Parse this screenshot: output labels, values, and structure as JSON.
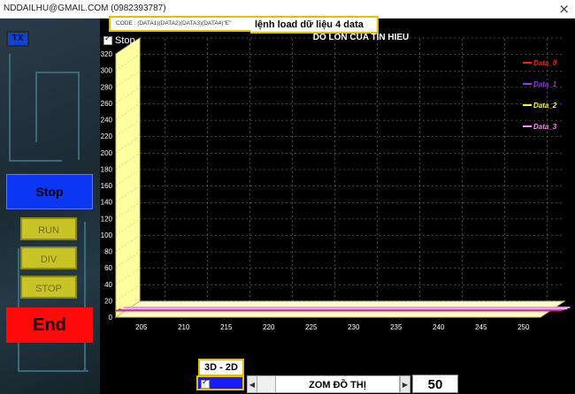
{
  "window": {
    "title": "NDDAILHU@GMAIL.COM (0982393787)",
    "close_glyph": "×"
  },
  "left_panel": {
    "tx_label": "TX",
    "stop_big_label": "Stop",
    "run_label": "RUN",
    "div_label": "DIV",
    "stop_small_label": "STOP",
    "end_label": "End"
  },
  "header": {
    "code_text": "CODE : (DATA1)(DATA2)(DATA3)(DATA4)\"E\"",
    "load_text": "lệnh load dữ liệu 4 data",
    "stop_check_label": "Stop"
  },
  "bottom": {
    "mode_label": "3D - 2D",
    "zoom_label": "ZOM ĐỒ THỊ",
    "zoom_value": "50",
    "left_arrow": "◀",
    "right_arrow": "▶"
  },
  "colors": {
    "background": "#000000",
    "grid": "#8a8a8a",
    "wall": "#ffffa0",
    "axis_text": "#ffffff"
  },
  "chart_data": {
    "type": "line",
    "title": "DO LON CUA TIN HIEU",
    "xlabel": "",
    "ylabel": "",
    "x_ticks": [
      205,
      210,
      215,
      220,
      225,
      230,
      235,
      240,
      245,
      250
    ],
    "y_ticks": [
      0,
      20,
      40,
      60,
      80,
      100,
      120,
      140,
      160,
      180,
      200,
      220,
      240,
      260,
      280,
      300,
      320
    ],
    "xlim": [
      202,
      252
    ],
    "ylim": [
      0,
      320
    ],
    "series": [
      {
        "name": "Data_0",
        "color": "#ff2020",
        "values": [
          8,
          8
        ]
      },
      {
        "name": "Data_1",
        "color": "#9933ff",
        "values": [
          6,
          6
        ]
      },
      {
        "name": "Data_2",
        "color": "#ffff00",
        "values": [
          4,
          4
        ]
      },
      {
        "name": "Data_3",
        "color": "#ff88ff",
        "values": [
          2,
          2
        ]
      }
    ],
    "legend_position": "right",
    "grid": true
  }
}
